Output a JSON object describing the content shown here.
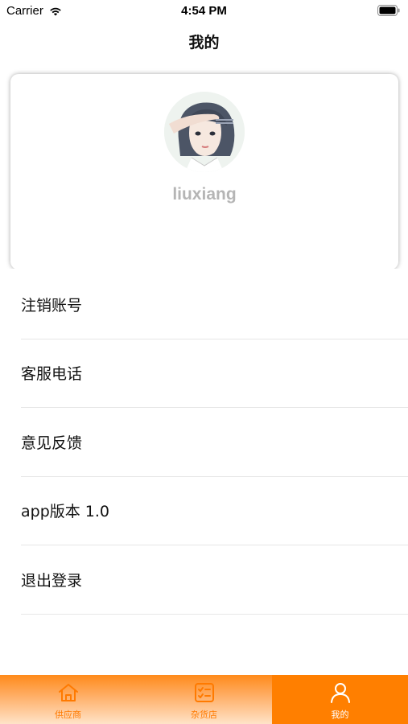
{
  "status_bar": {
    "carrier": "Carrier",
    "time": "4:54 PM"
  },
  "nav": {
    "title": "我的"
  },
  "profile": {
    "username": "liuxiang"
  },
  "menu": {
    "items": [
      {
        "label": "注销账号"
      },
      {
        "label": "客服电话"
      },
      {
        "label": "意见反馈"
      },
      {
        "label": "app版本 1.0"
      },
      {
        "label": "退出登录"
      }
    ]
  },
  "tabbar": {
    "tabs": [
      {
        "label": "供应商",
        "icon": "home-icon",
        "active": false
      },
      {
        "label": "杂货店",
        "icon": "checklist-icon",
        "active": false
      },
      {
        "label": "我的",
        "icon": "person-icon",
        "active": true
      }
    ]
  },
  "colors": {
    "accent": "#ff7f00",
    "username": "#b5b5b5",
    "divider": "#e6e6e6"
  }
}
